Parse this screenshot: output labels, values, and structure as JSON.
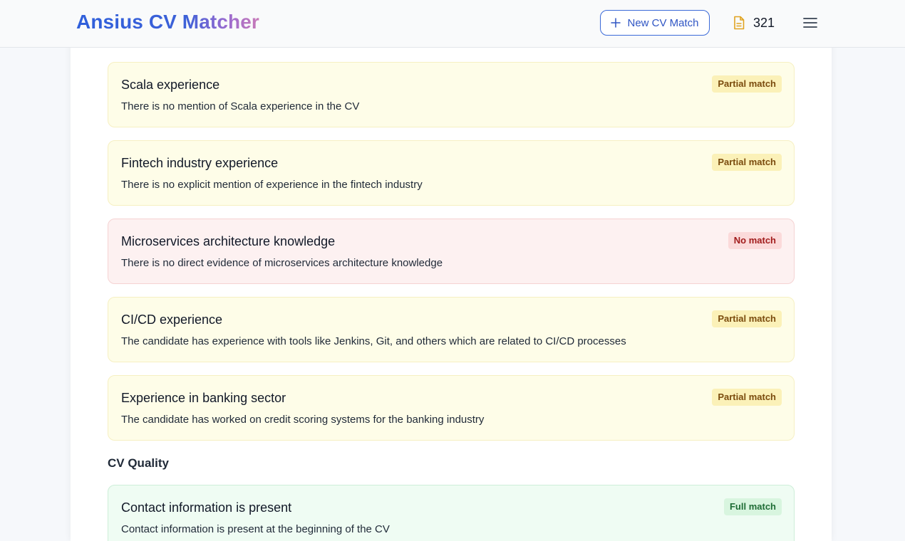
{
  "header": {
    "logo": "Ansius CV Matcher",
    "new_button_label": "New CV Match",
    "credits": "321"
  },
  "requirements": [
    {
      "title": "Scala experience",
      "description": "There is no mention of Scala experience in the CV",
      "status": "Partial match"
    },
    {
      "title": "Fintech industry experience",
      "description": "There is no explicit mention of experience in the fintech industry",
      "status": "Partial match"
    },
    {
      "title": "Microservices architecture knowledge",
      "description": "There is no direct evidence of microservices architecture knowledge",
      "status": "No match"
    },
    {
      "title": "CI/CD experience",
      "description": "The candidate has experience with tools like Jenkins, Git, and others which are related to CI/CD processes",
      "status": "Partial match"
    },
    {
      "title": "Experience in banking sector",
      "description": "The candidate has worked on credit scoring systems for the banking industry",
      "status": "Partial match"
    }
  ],
  "cv_quality": {
    "heading": "CV Quality",
    "items": [
      {
        "title": "Contact information is present",
        "description": "Contact information is present at the beginning of the CV",
        "status": "Full match"
      }
    ]
  },
  "colors": {
    "brand": "#3b6ad8",
    "partial_bg": "#fefde8",
    "none_bg": "#fdf1f1",
    "full_bg": "#effcf3"
  },
  "icons": {
    "new_button": "plus-icon",
    "credits": "document-icon",
    "menu": "hamburger-menu-icon"
  }
}
